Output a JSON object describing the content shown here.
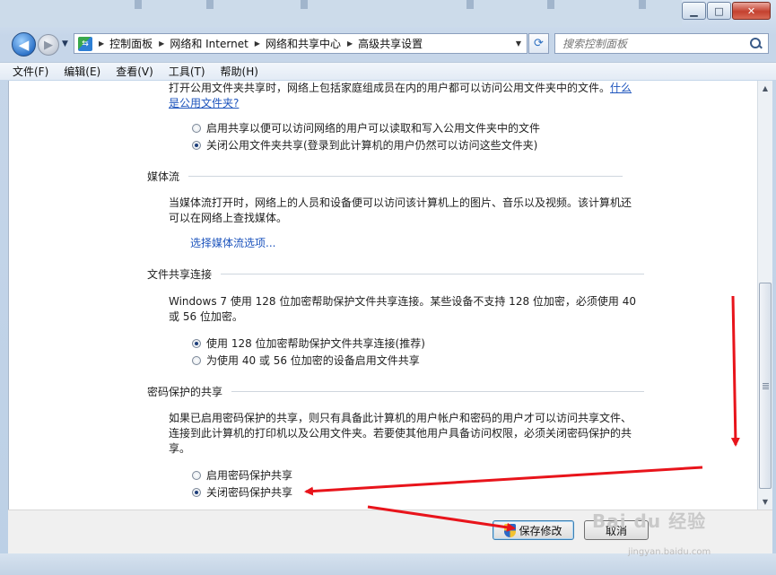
{
  "window": {
    "minimize_glyph": "▁",
    "maximize_glyph": "□",
    "close_glyph": "✕"
  },
  "address_bar": {
    "crumbs": [
      "控制面板",
      "网络和 Internet",
      "网络和共享中心",
      "高级共享设置"
    ]
  },
  "search": {
    "placeholder": "搜索控制面板"
  },
  "menu": {
    "items": [
      "文件(F)",
      "编辑(E)",
      "查看(V)",
      "工具(T)",
      "帮助(H)"
    ]
  },
  "public_folder": {
    "text": "打开公用文件夹共享时，网络上包括家庭组成员在内的用户都可以访问公用文件夹中的文件。",
    "link_part1": "什么",
    "link_part2": "是公用文件夹?",
    "options": [
      {
        "label": "启用共享以便可以访问网络的用户可以读取和写入公用文件夹中的文件",
        "checked": false
      },
      {
        "label": "关闭公用文件夹共享(登录到此计算机的用户仍然可以访问这些文件夹)",
        "checked": true
      }
    ]
  },
  "media_streaming": {
    "title": "媒体流",
    "text_line1": "当媒体流打开时，网络上的人员和设备便可以访问该计算机上的图片、音乐以及视频。该计算机还",
    "text_line2": "可以在网络上查找媒体。",
    "link": "选择媒体流选项..."
  },
  "file_sharing_connections": {
    "title": "文件共享连接",
    "text_line1": "Windows 7 使用 128 位加密帮助保护文件共享连接。某些设备不支持 128 位加密，必须使用 40",
    "text_line2": "或 56 位加密。",
    "options": [
      {
        "label": "使用 128 位加密帮助保护文件共享连接(推荐)",
        "checked": true
      },
      {
        "label": "为使用 40 或 56 位加密的设备启用文件共享",
        "checked": false
      }
    ]
  },
  "password_protected_sharing": {
    "title": "密码保护的共享",
    "text_line1": "如果已启用密码保护的共享，则只有具备此计算机的用户帐户和密码的用户才可以访问共享文件、",
    "text_line2": "连接到此计算机的打印机以及公用文件夹。若要使其他用户具备访问权限，必须关闭密码保护的共",
    "text_line3": "享。",
    "options": [
      {
        "label": "启用密码保护共享",
        "checked": false
      },
      {
        "label": "关闭密码保护共享",
        "checked": true
      }
    ]
  },
  "footer": {
    "save_label": "保存修改",
    "cancel_label": "取消"
  },
  "watermark": {
    "brand": "Bai du 经验",
    "url": "jingyan.baidu.com"
  },
  "colors": {
    "annotation_arrow": "#e8141b",
    "link": "#1d54bd"
  }
}
